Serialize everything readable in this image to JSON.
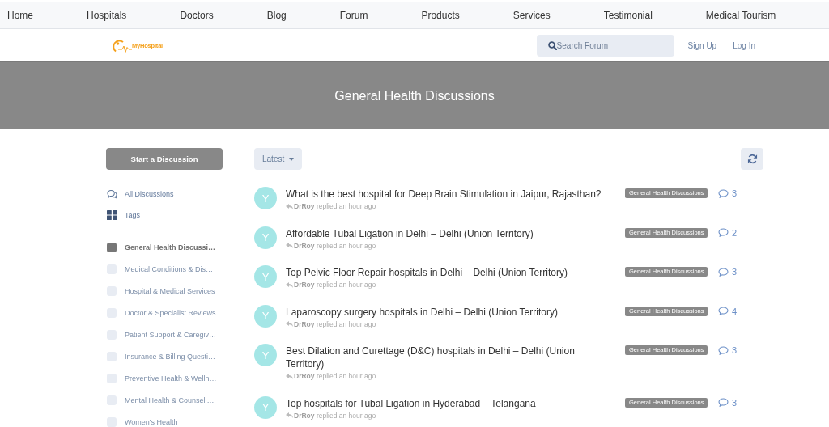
{
  "top_nav": {
    "items": [
      "Home",
      "Hospitals",
      "Doctors",
      "Blog",
      "Forum",
      "Products",
      "Services",
      "Testimonial",
      "Medical Tourism"
    ]
  },
  "header": {
    "logo": "MyHospital",
    "search": {
      "placeholder": "Search Forum"
    },
    "links": [
      "Sign Up",
      "Log In"
    ]
  },
  "hero": {
    "title": "General Health Discussions"
  },
  "sidebar": {
    "start_button": "Start a Discussion",
    "nav": [
      {
        "kind": "discussions",
        "label": "All Discussions"
      },
      {
        "kind": "tags",
        "label": "Tags"
      }
    ],
    "tags": [
      {
        "label": "General Health Discussi…",
        "selected": true
      },
      {
        "label": "Medical Conditions & Dis…",
        "selected": false
      },
      {
        "label": "Hospital & Medical Services",
        "selected": false
      },
      {
        "label": "Doctor & Specialist Reviews",
        "selected": false
      },
      {
        "label": "Patient Support & Caregiv…",
        "selected": false
      },
      {
        "label": "Insurance & Billing Questi…",
        "selected": false
      },
      {
        "label": "Preventive Health & Welln…",
        "selected": false
      },
      {
        "label": "Mental Health & Counseli…",
        "selected": false
      },
      {
        "label": "Women's Health",
        "selected": false
      }
    ]
  },
  "toolbar": {
    "sort": "Latest"
  },
  "discussions": [
    {
      "avatar": "Y",
      "title": "What is the best hospital for Deep Brain Stimulation in Jaipur, Rajasthan?",
      "meta": "**DrRoy** replied an hour ago",
      "tag": "General Health Discussions",
      "replies": "3"
    },
    {
      "avatar": "Y",
      "title": "Affordable Tubal Ligation in Delhi – Delhi (Union Territory)",
      "meta": "**DrRoy** replied an hour ago",
      "tag": "General Health Discussions",
      "replies": "2"
    },
    {
      "avatar": "Y",
      "title": "Top Pelvic Floor Repair hospitals in Delhi – Delhi (Union Territory)",
      "meta": "**DrRoy** replied an hour ago",
      "tag": "General Health Discussions",
      "replies": "3"
    },
    {
      "avatar": "Y",
      "title": "Laparoscopy surgery hospitals in Delhi – Delhi (Union Territory)",
      "meta": "**DrRoy** replied an hour ago",
      "tag": "General Health Discussions",
      "replies": "4"
    },
    {
      "avatar": "Y",
      "title": "Best Dilation and Curettage (D&C) hospitals in Delhi – Delhi (Union Territory)",
      "meta": "**DrRoy** replied an hour ago",
      "tag": "General Health Discussions",
      "replies": "3"
    },
    {
      "avatar": "Y",
      "title": "Top hospitals for Tubal Ligation in Hyderabad – Telangana",
      "meta": "**DrRoy** replied an hour ago",
      "tag": "General Health Discussions",
      "replies": "3"
    }
  ]
}
